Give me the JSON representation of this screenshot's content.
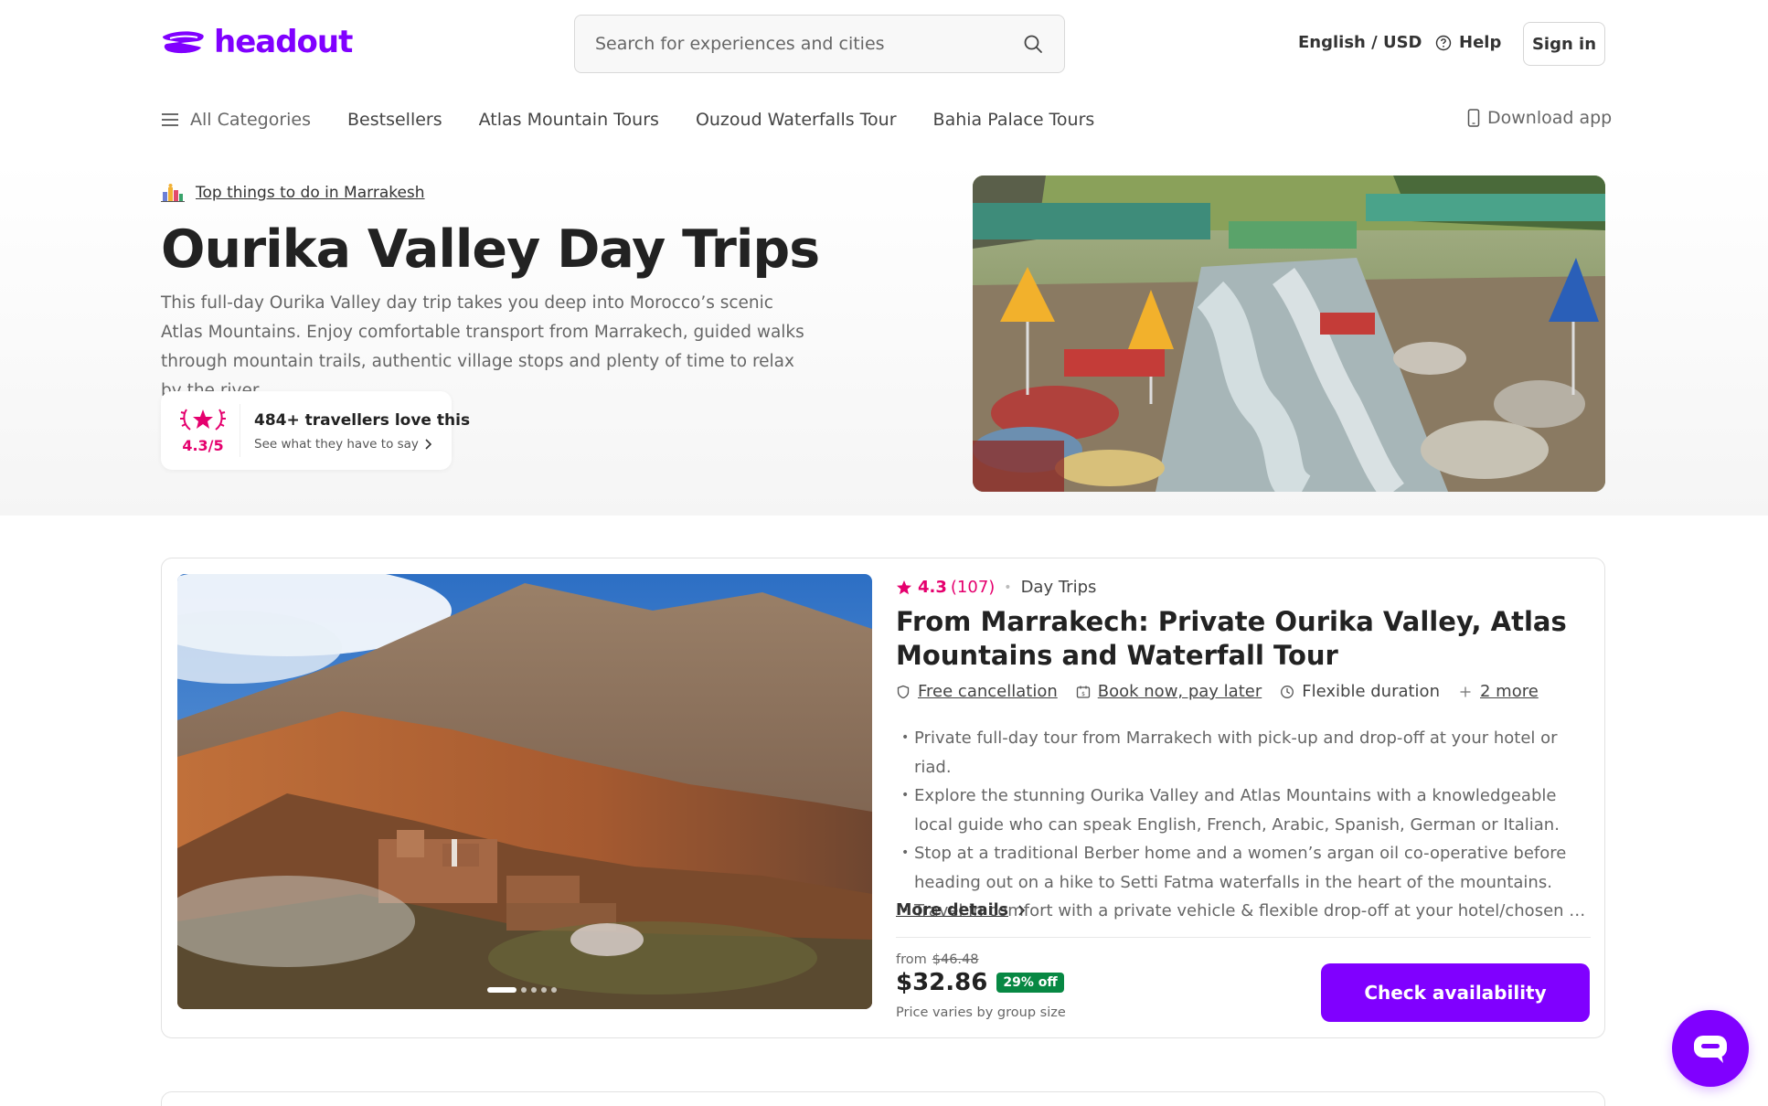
{
  "header": {
    "logo_text": "headout",
    "search_placeholder": "Search for experiences and cities",
    "language": "English / USD",
    "help": "Help",
    "sign_in": "Sign in"
  },
  "nav": {
    "all_categories": "All Categories",
    "items": [
      "Bestsellers",
      "Atlas Mountain Tours",
      "Ouzoud Waterfalls Tour",
      "Bahia Palace Tours"
    ],
    "download_app": "Download app"
  },
  "hero": {
    "breadcrumb": "Top things to do in Marrakesh",
    "title": "Ourika Valley Day Trips",
    "description": "This full-day Ourika Valley day trip takes you deep into Morocco’s scenic Atlas Mountains. Enjoy comfortable transport from Marrakech, guided walks through mountain trails, authentic village stops and plenty of time to relax by the river.",
    "rating": "4.3/5",
    "travellers": "484+ travellers love this",
    "see_reviews": "See what they have to say"
  },
  "product": {
    "rating": "4.3",
    "review_count": "(107)",
    "category": "Day Trips",
    "title": "From Marrakech: Private Ourika Valley, Atlas Mountains and Waterfall Tour",
    "features": [
      "Free cancellation",
      "Book now, pay later",
      "Flexible duration",
      "2 more"
    ],
    "bullets": [
      "Private full-day tour from Marrakech with pick-up and drop-off at your hotel or riad.",
      "Explore the stunning Ourika Valley and Atlas Mountains with a knowledgeable local guide who can speak   English, French, Arabic, Spanish, German or Italian.",
      "Stop at a traditional Berber home and a women’s argan oil co-operative before heading out on a hike to Setti Fatma waterfalls in the heart of the mountains.",
      "Travel in comfort with a private vehicle & flexible drop-off at your hotel/chosen spot."
    ],
    "more_details": "More details",
    "from_label": "from",
    "original_price": "$46.48",
    "price": "$32.86",
    "discount": "29% off",
    "price_note": "Price varies by group size",
    "cta": "Check availability",
    "carousel_count": 5,
    "carousel_active": 1
  },
  "colors": {
    "brand": "#8000ff",
    "rating": "#e5006e",
    "discount": "#078843"
  },
  "icons": [
    "logo-icon",
    "search-icon",
    "help-icon",
    "menu-icon",
    "phone-icon",
    "city-icon",
    "laurel-star-icon",
    "star-icon",
    "shield-icon",
    "calendar-icon",
    "clock-icon",
    "plus-icon",
    "chevron-right-icon",
    "chat-icon"
  ]
}
